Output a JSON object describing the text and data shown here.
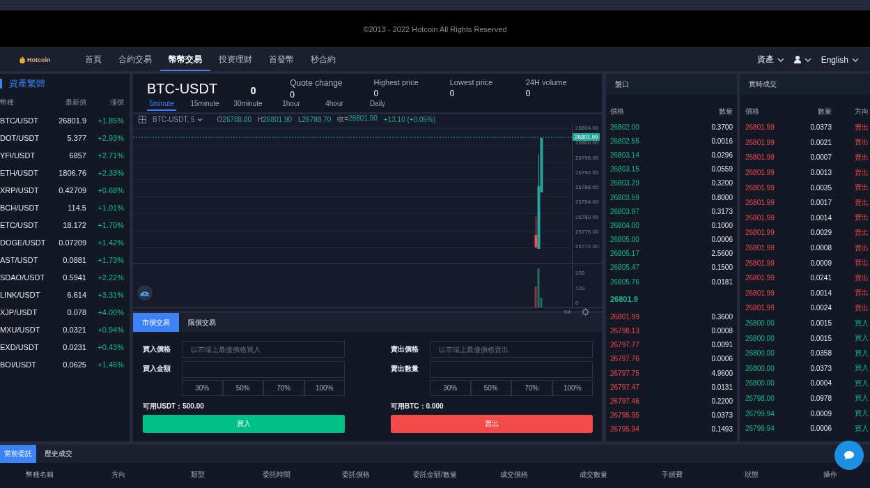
{
  "footer": {
    "copyright": "©2013 - 2022 Hotcoin All Rights Reserved"
  },
  "nav": {
    "logo": "Hotcoin",
    "items": [
      {
        "label": "首頁",
        "selected": false
      },
      {
        "label": "合約交易",
        "selected": false
      },
      {
        "label": "幣幣交易",
        "selected": true
      },
      {
        "label": "投资理财",
        "selected": false
      },
      {
        "label": "首發幣",
        "selected": false
      },
      {
        "label": "秒合約",
        "selected": false
      }
    ],
    "assets": "資產",
    "language": "English"
  },
  "market": {
    "title": "資產繁體",
    "columns": [
      "幣種",
      "最新價",
      "漲價"
    ],
    "rows": [
      {
        "pair": "BTC/USDT",
        "price": "26801.9",
        "change": "+1.85%"
      },
      {
        "pair": "DOT/USDT",
        "price": "5.377",
        "change": "+2.93%"
      },
      {
        "pair": "YFI/USDT",
        "price": "6857",
        "change": "+2.71%"
      },
      {
        "pair": "ETH/USDT",
        "price": "1806.76",
        "change": "+2.33%"
      },
      {
        "pair": "XRP/USDT",
        "price": "0.42709",
        "change": "+0.68%"
      },
      {
        "pair": "BCH/USDT",
        "price": "114.5",
        "change": "+1.01%"
      },
      {
        "pair": "ETC/USDT",
        "price": "18.172",
        "change": "+1.70%"
      },
      {
        "pair": "DOGE/USDT",
        "price": "0.07209",
        "change": "+1.42%"
      },
      {
        "pair": "AST/USDT",
        "price": "0.0881",
        "change": "+1.73%"
      },
      {
        "pair": "SDAO/USDT",
        "price": "0.5941",
        "change": "+2.22%"
      },
      {
        "pair": "LINK/USDT",
        "price": "6.614",
        "change": "+3.31%"
      },
      {
        "pair": "XJP/USDT",
        "price": "0.078",
        "change": "+4.00%"
      },
      {
        "pair": "MXU/USDT",
        "price": "0.0321",
        "change": "+0.94%"
      },
      {
        "pair": "EXD/USDT",
        "price": "0.0231",
        "change": "+0.43%"
      },
      {
        "pair": "BOI/USDT",
        "price": "0.0625",
        "change": "+1.46%"
      }
    ]
  },
  "ticker": {
    "symbol": "BTC-USDT",
    "price": "0",
    "stats": [
      {
        "label": "Quote change",
        "value": "0"
      },
      {
        "label": "Highest price",
        "value": "0"
      },
      {
        "label": "Lowest price",
        "value": "0"
      },
      {
        "label": "24H volume",
        "value": "0"
      }
    ],
    "intervals": [
      {
        "label": "5minute",
        "selected": true
      },
      {
        "label": "15minute",
        "selected": false
      },
      {
        "label": "30minute",
        "selected": false
      },
      {
        "label": "1hour",
        "selected": false
      },
      {
        "label": "4hour",
        "selected": false
      },
      {
        "label": "Daily",
        "selected": false
      }
    ]
  },
  "chart": {
    "symbol": "BTC-USDT, 5",
    "legend": [
      {
        "label": "O",
        "value": "26788.80"
      },
      {
        "label": "H",
        "value": "26801.90"
      },
      {
        "label": "L",
        "value": "26788.70"
      },
      {
        "label": "收=",
        "value": "26801.90"
      }
    ],
    "change": "+13.10 (+0.05%)",
    "last_price": "26801.90",
    "price_ticks": [
      "26804.00",
      "26800.00",
      "26796.00",
      "26792.00",
      "26788.00",
      "26784.00",
      "26780.00",
      "26776.00",
      "26772.00"
    ],
    "volume_ticks": [
      "200",
      "100",
      "0"
    ],
    "time_label": "04:"
  },
  "trade": {
    "tabs": [
      {
        "label": "市價交易",
        "selected": true
      },
      {
        "label": "限價交易",
        "selected": false
      }
    ],
    "sides": [
      {
        "kind": "buy",
        "price_label": "買入價格",
        "placeholder": "以市場上最優價格買入",
        "amount_label": "買入金額",
        "percents": [
          "30%",
          "50%",
          "70%",
          "100%"
        ],
        "available": "可用USDT：500.00",
        "button": "買入"
      },
      {
        "kind": "sell",
        "price_label": "賣出價格",
        "placeholder": "以市場上最優價格賣出",
        "amount_label": "賣出數量",
        "percents": [
          "30%",
          "50%",
          "70%",
          "100%"
        ],
        "available": "可用BTC：0.000",
        "button": "賣出"
      }
    ]
  },
  "order_book": {
    "title": "盤口",
    "columns": [
      "價格",
      "數量"
    ],
    "upper": [
      {
        "price": "26802.00",
        "amount": "0.3700"
      },
      {
        "price": "26802.55",
        "amount": "0.0016"
      },
      {
        "price": "26803.14",
        "amount": "0.0296"
      },
      {
        "price": "26803.15",
        "amount": "0.0559"
      },
      {
        "price": "26803.29",
        "amount": "0.3200"
      },
      {
        "price": "26803.59",
        "amount": "0.8000"
      },
      {
        "price": "26803.97",
        "amount": "0.3173"
      },
      {
        "price": "26804.00",
        "amount": "0.1000"
      },
      {
        "price": "26805.00",
        "amount": "0.0006"
      },
      {
        "price": "26805.17",
        "amount": "2.5600"
      },
      {
        "price": "26805.47",
        "amount": "0.1500"
      },
      {
        "price": "26805.76",
        "amount": "0.0181"
      }
    ],
    "last": "26801.9",
    "lower": [
      {
        "price": "26801.99",
        "amount": "0.3600"
      },
      {
        "price": "26798.13",
        "amount": "0.0008"
      },
      {
        "price": "26797.77",
        "amount": "0.0091"
      },
      {
        "price": "26797.76",
        "amount": "0.0006"
      },
      {
        "price": "26797.75",
        "amount": "4.9600"
      },
      {
        "price": "26797.47",
        "amount": "0.0131"
      },
      {
        "price": "26797.46",
        "amount": "0.2200"
      },
      {
        "price": "26795.95",
        "amount": "0.0373"
      },
      {
        "price": "26795.94",
        "amount": "0.1493"
      }
    ]
  },
  "trades": {
    "title": "實時成交",
    "columns": [
      "價格",
      "數量",
      "方向"
    ],
    "rows": [
      {
        "price": "26801.99",
        "amount": "0.0373",
        "direction": "賣出",
        "kind": "sell"
      },
      {
        "price": "26801.99",
        "amount": "0.0021",
        "direction": "賣出",
        "kind": "sell"
      },
      {
        "price": "26801.99",
        "amount": "0.0007",
        "direction": "賣出",
        "kind": "sell"
      },
      {
        "price": "26801.99",
        "amount": "0.0013",
        "direction": "賣出",
        "kind": "sell"
      },
      {
        "price": "26801.99",
        "amount": "0.0035",
        "direction": "賣出",
        "kind": "sell"
      },
      {
        "price": "26801.99",
        "amount": "0.0017",
        "direction": "賣出",
        "kind": "sell"
      },
      {
        "price": "26801.99",
        "amount": "0.0014",
        "direction": "賣出",
        "kind": "sell"
      },
      {
        "price": "26801.99",
        "amount": "0.0029",
        "direction": "賣出",
        "kind": "sell"
      },
      {
        "price": "26801.99",
        "amount": "0.0008",
        "direction": "賣出",
        "kind": "sell"
      },
      {
        "price": "26801.99",
        "amount": "0.0009",
        "direction": "賣出",
        "kind": "sell"
      },
      {
        "price": "26801.99",
        "amount": "0.0241",
        "direction": "賣出",
        "kind": "sell"
      },
      {
        "price": "26801.99",
        "amount": "0.0014",
        "direction": "賣出",
        "kind": "sell"
      },
      {
        "price": "26801.99",
        "amount": "0.0024",
        "direction": "賣出",
        "kind": "sell"
      },
      {
        "price": "26800.00",
        "amount": "0.0015",
        "direction": "買入",
        "kind": "buy"
      },
      {
        "price": "26800.00",
        "amount": "0.0015",
        "direction": "買入",
        "kind": "buy"
      },
      {
        "price": "26800.00",
        "amount": "0.0358",
        "direction": "買入",
        "kind": "buy"
      },
      {
        "price": "26800.00",
        "amount": "0.0373",
        "direction": "買入",
        "kind": "buy"
      },
      {
        "price": "26800.00",
        "amount": "0.0004",
        "direction": "買入",
        "kind": "buy"
      },
      {
        "price": "26798.00",
        "amount": "0.0978",
        "direction": "買入",
        "kind": "buy"
      },
      {
        "price": "26799.94",
        "amount": "0.0009",
        "direction": "買入",
        "kind": "buy"
      },
      {
        "price": "26799.94",
        "amount": "0.0006",
        "direction": "買入",
        "kind": "buy"
      }
    ]
  },
  "orders": {
    "tabs": [
      {
        "label": "當前委託",
        "selected": true
      },
      {
        "label": "歷史成交",
        "selected": false
      }
    ],
    "columns": [
      "幣種名稱",
      "方向",
      "類型",
      "委託時間",
      "委託價格",
      "委託金額/數量",
      "成交價格",
      "成交數量",
      "手續費",
      "狀態",
      "操作"
    ]
  }
}
